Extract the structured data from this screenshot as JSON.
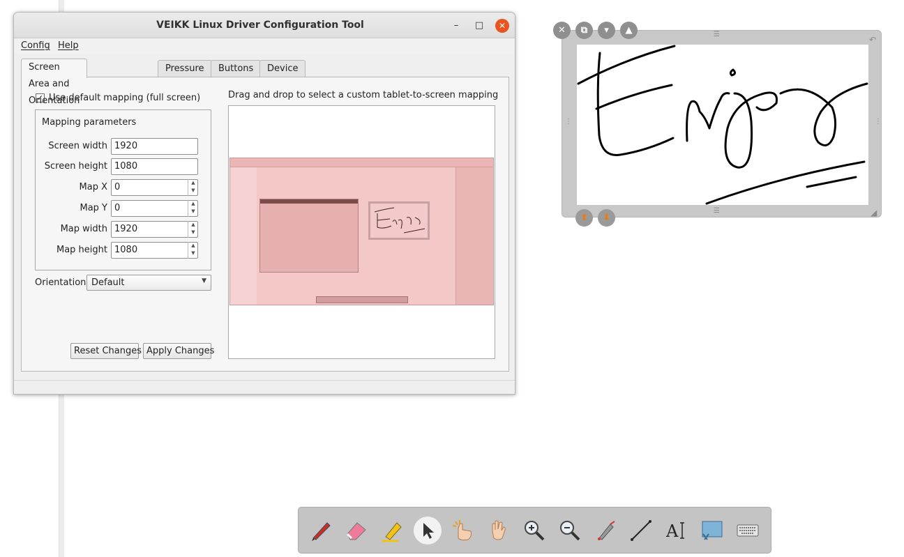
{
  "dialog": {
    "title": "VEIKK Linux Driver Configuration Tool",
    "window_controls": {
      "minimize": "–",
      "maximize": "□",
      "close": "✕"
    },
    "menu": [
      "Config",
      "Help"
    ],
    "tabs": [
      "Screen Area and Orientation",
      "Pressure",
      "Buttons",
      "Device Info"
    ],
    "active_tab": "Screen Area and Orientation",
    "use_default": {
      "label": "Use default mapping (full screen)",
      "checked": true,
      "mark": "✓"
    },
    "group_title": "Mapping parameters",
    "fields": [
      {
        "label": "Screen width",
        "value": "1920",
        "spin": false
      },
      {
        "label": "Screen height",
        "value": "1080",
        "spin": false
      },
      {
        "label": "Map X",
        "value": "0",
        "spin": true
      },
      {
        "label": "Map Y",
        "value": "0",
        "spin": true
      },
      {
        "label": "Map width",
        "value": "1920",
        "spin": true
      },
      {
        "label": "Map height",
        "value": "1080",
        "spin": true
      }
    ],
    "orientation_label": "Orientation",
    "orientation_value": "Default",
    "reset_button": "Reset Changes",
    "apply_button": "Apply Changes",
    "drag_label": "Drag and drop to select a custom tablet-to-screen mapping"
  },
  "signature_widget": {
    "icons": [
      "close-icon",
      "copy-icon",
      "dropdown-icon",
      "shapes-icon",
      "layer-up-icon",
      "layer-down-icon"
    ],
    "accent": "#e87b16"
  },
  "toolbar": {
    "tools": [
      "pen",
      "eraser",
      "highlighter",
      "select",
      "interact",
      "pan",
      "zoom-in",
      "zoom-out",
      "laser-pointer",
      "line",
      "text",
      "capture",
      "keyboard"
    ],
    "selected": "select"
  },
  "colors": {
    "title_close": "#e95420",
    "preview_tint": "#f5c8c8"
  }
}
